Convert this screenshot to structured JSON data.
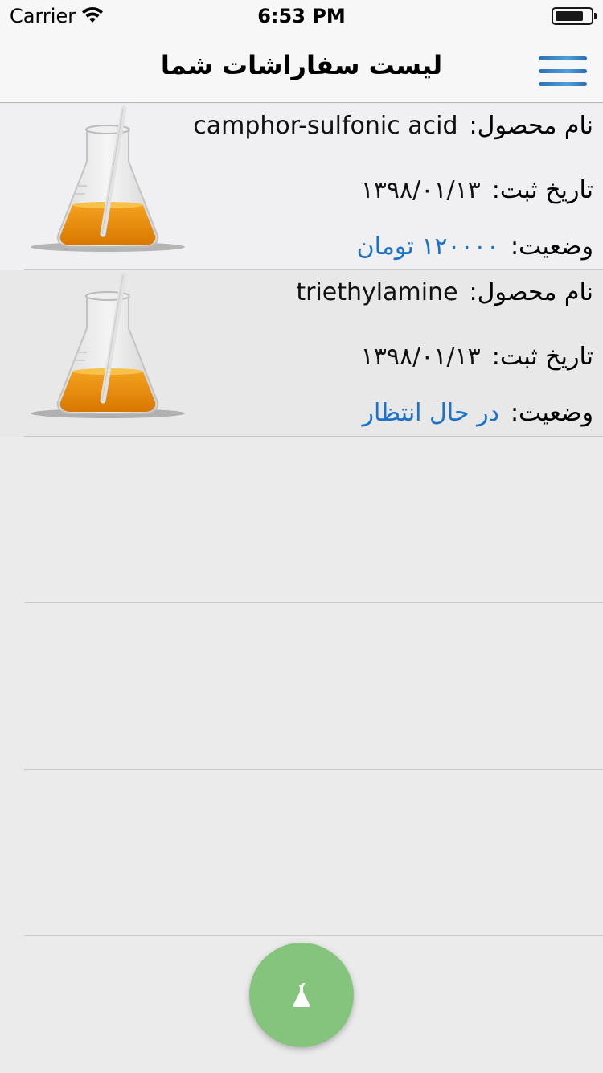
{
  "status_bar": {
    "carrier": "Carrier",
    "time": "6:53 PM"
  },
  "nav": {
    "title": "لیست سفاراشات شما",
    "menu_icon": "hamburger-menu-icon"
  },
  "orders": [
    {
      "product_label": "نام محصول:",
      "product_name": "camphor-sulfonic acid",
      "date_label": "تاریخ ثبت:",
      "date_value": "۱۳۹۸/۰۱/۱۳",
      "status_label": "وضعیت:",
      "status_value": "۱۲۰۰۰۰ تومان",
      "image_icon": "erlenmeyer-flask-image"
    },
    {
      "product_label": "نام محصول:",
      "product_name": "triethylamine",
      "date_label": "تاریخ ثبت:",
      "date_value": "۱۳۹۸/۰۱/۱۳",
      "status_label": "وضعیت:",
      "status_value": "در حال انتظار",
      "image_icon": "erlenmeyer-flask-image"
    }
  ],
  "fab": {
    "icon": "flask-icon"
  },
  "colors": {
    "accent_blue": "#1a73c9",
    "fab_green": "#85c47d",
    "liquid_orange": "#e8900c"
  }
}
